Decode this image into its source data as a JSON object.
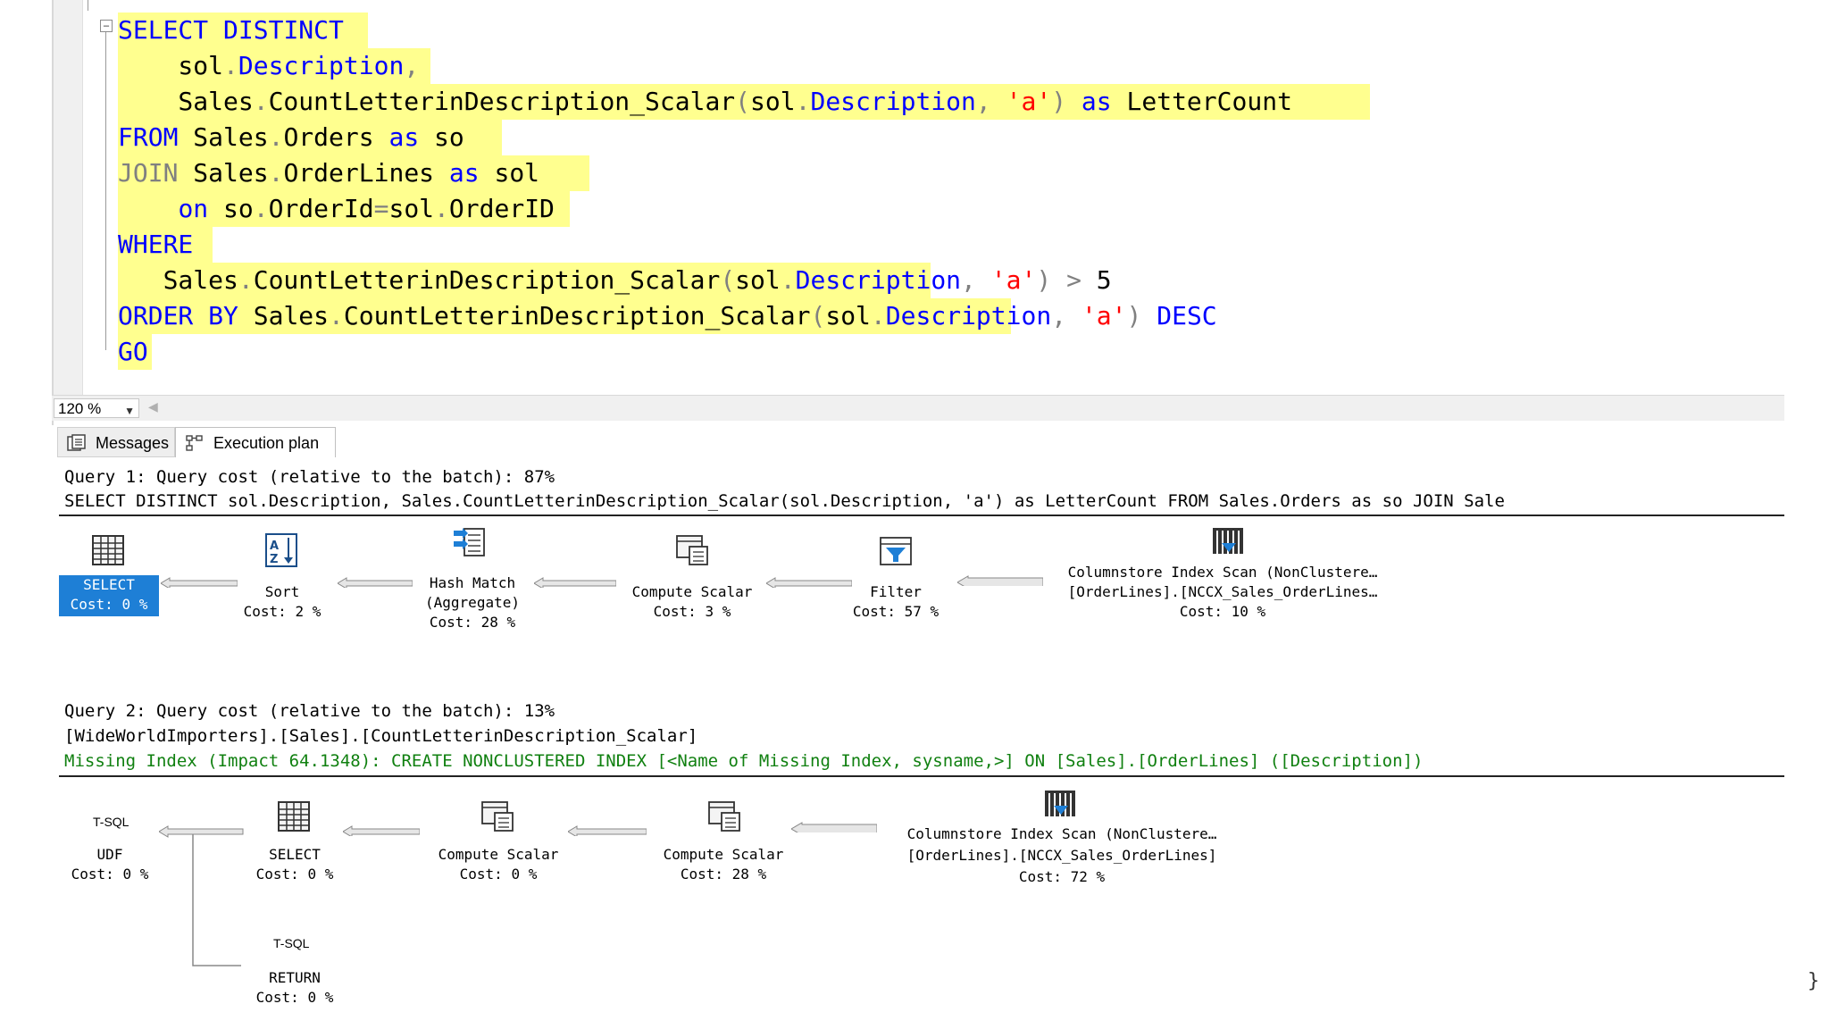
{
  "editor": {
    "lines": [
      {
        "parts": [
          {
            "t": "SELECT",
            "c": "kw"
          },
          {
            "t": " ",
            "c": "fn"
          },
          {
            "t": "DISTINCT",
            "c": "kw"
          }
        ]
      },
      {
        "parts": [
          {
            "t": "    sol",
            "c": "fn"
          },
          {
            "t": ".",
            "c": "gr"
          },
          {
            "t": "Description",
            "c": "kw"
          },
          {
            "t": ",",
            "c": "gr"
          }
        ]
      },
      {
        "parts": [
          {
            "t": "    Sales",
            "c": "fn"
          },
          {
            "t": ".",
            "c": "gr"
          },
          {
            "t": "CountLetterinDescription_Scalar",
            "c": "fn"
          },
          {
            "t": "(",
            "c": "gr"
          },
          {
            "t": "sol",
            "c": "fn"
          },
          {
            "t": ".",
            "c": "gr"
          },
          {
            "t": "Description",
            "c": "kw"
          },
          {
            "t": ",",
            "c": "gr"
          },
          {
            "t": " ",
            "c": "fn"
          },
          {
            "t": "'a'",
            "c": "str"
          },
          {
            "t": ")",
            "c": "gr"
          },
          {
            "t": " ",
            "c": "fn"
          },
          {
            "t": "as",
            "c": "kw"
          },
          {
            "t": " LetterCount",
            "c": "fn"
          }
        ]
      },
      {
        "parts": [
          {
            "t": "FROM",
            "c": "kw"
          },
          {
            "t": " Sales",
            "c": "fn"
          },
          {
            "t": ".",
            "c": "gr"
          },
          {
            "t": "Orders ",
            "c": "fn"
          },
          {
            "t": "as",
            "c": "kw"
          },
          {
            "t": " so",
            "c": "fn"
          }
        ]
      },
      {
        "parts": [
          {
            "t": "JOIN",
            "c": "gr"
          },
          {
            "t": " Sales",
            "c": "fn"
          },
          {
            "t": ".",
            "c": "gr"
          },
          {
            "t": "OrderLines ",
            "c": "fn"
          },
          {
            "t": "as",
            "c": "kw"
          },
          {
            "t": " sol",
            "c": "fn"
          }
        ]
      },
      {
        "parts": [
          {
            "t": "    ",
            "c": "fn"
          },
          {
            "t": "on",
            "c": "kw"
          },
          {
            "t": " so",
            "c": "fn"
          },
          {
            "t": ".",
            "c": "gr"
          },
          {
            "t": "OrderId",
            "c": "fn"
          },
          {
            "t": "=",
            "c": "gr"
          },
          {
            "t": "sol",
            "c": "fn"
          },
          {
            "t": ".",
            "c": "gr"
          },
          {
            "t": "OrderID",
            "c": "fn"
          }
        ]
      },
      {
        "parts": [
          {
            "t": "WHERE",
            "c": "kw"
          }
        ]
      },
      {
        "parts": [
          {
            "t": "   Sales",
            "c": "fn"
          },
          {
            "t": ".",
            "c": "gr"
          },
          {
            "t": "CountLetterinDescription_Scalar",
            "c": "fn"
          },
          {
            "t": "(",
            "c": "gr"
          },
          {
            "t": "sol",
            "c": "fn"
          },
          {
            "t": ".",
            "c": "gr"
          },
          {
            "t": "Description",
            "c": "kw"
          },
          {
            "t": ",",
            "c": "gr"
          },
          {
            "t": " ",
            "c": "fn"
          },
          {
            "t": "'a'",
            "c": "str"
          },
          {
            "t": ")",
            "c": "gr"
          },
          {
            "t": " ",
            "c": "fn"
          },
          {
            "t": ">",
            "c": "gr"
          },
          {
            "t": " 5",
            "c": "fn"
          }
        ]
      },
      {
        "parts": [
          {
            "t": "ORDER",
            "c": "kw"
          },
          {
            "t": " ",
            "c": "fn"
          },
          {
            "t": "BY",
            "c": "kw"
          },
          {
            "t": " Sales",
            "c": "fn"
          },
          {
            "t": ".",
            "c": "gr"
          },
          {
            "t": "CountLetterinDescription_Scalar",
            "c": "fn"
          },
          {
            "t": "(",
            "c": "gr"
          },
          {
            "t": "sol",
            "c": "fn"
          },
          {
            "t": ".",
            "c": "gr"
          },
          {
            "t": "Description",
            "c": "kw"
          },
          {
            "t": ",",
            "c": "gr"
          },
          {
            "t": " ",
            "c": "fn"
          },
          {
            "t": "'a'",
            "c": "str"
          },
          {
            "t": ")",
            "c": "gr"
          },
          {
            "t": " ",
            "c": "fn"
          },
          {
            "t": "DESC",
            "c": "kw"
          }
        ]
      },
      {
        "parts": [
          {
            "t": "GO",
            "c": "kw"
          }
        ]
      }
    ]
  },
  "zoom": {
    "value": "120 %"
  },
  "tabs": {
    "messages": "Messages",
    "plan": "Execution plan"
  },
  "query1": {
    "header": "Query 1: Query cost (relative to the batch): 87%",
    "sql": "SELECT DISTINCT sol.Description, Sales.CountLetterinDescription_Scalar(sol.Description, 'a') as LetterCount FROM Sales.Orders as so JOIN Sale",
    "nodes": {
      "select": {
        "label": "SELECT",
        "cost": "Cost: 0 %"
      },
      "sort": {
        "label": "Sort",
        "cost": "Cost: 2 %"
      },
      "hash": {
        "label": "Hash Match",
        "sub": "(Aggregate)",
        "cost": "Cost: 28 %"
      },
      "compute": {
        "label": "Compute Scalar",
        "cost": "Cost: 3 %"
      },
      "filter": {
        "label": "Filter",
        "cost": "Cost: 57 %"
      },
      "scan": {
        "label": "Columnstore Index Scan (NonClustere…",
        "sub": "[OrderLines].[NCCX_Sales_OrderLines…",
        "cost": "Cost: 10 %"
      }
    }
  },
  "query2": {
    "header": "Query 2: Query cost (relative to the batch): 13%",
    "sql": "[WideWorldImporters].[Sales].[CountLetterinDescription_Scalar]",
    "missing": "Missing Index (Impact 64.1348): CREATE NONCLUSTERED INDEX [<Name of Missing Index, sysname,>] ON [Sales].[OrderLines] ([Description])",
    "nodes": {
      "udf": {
        "tag": "T-SQL",
        "label": "UDF",
        "cost": "Cost: 0 %"
      },
      "select": {
        "label": "SELECT",
        "cost": "Cost: 0 %"
      },
      "compute1": {
        "label": "Compute Scalar",
        "cost": "Cost: 0 %"
      },
      "compute2": {
        "label": "Compute Scalar",
        "cost": "Cost: 28 %"
      },
      "scan": {
        "label": "Columnstore Index Scan (NonClustere…",
        "sub": "[OrderLines].[NCCX_Sales_OrderLines]",
        "cost": "Cost: 72 %"
      },
      "return": {
        "tag": "T-SQL",
        "label": "RETURN",
        "cost": "Cost: 0 %"
      }
    }
  },
  "misc": {
    "brace": "}"
  }
}
